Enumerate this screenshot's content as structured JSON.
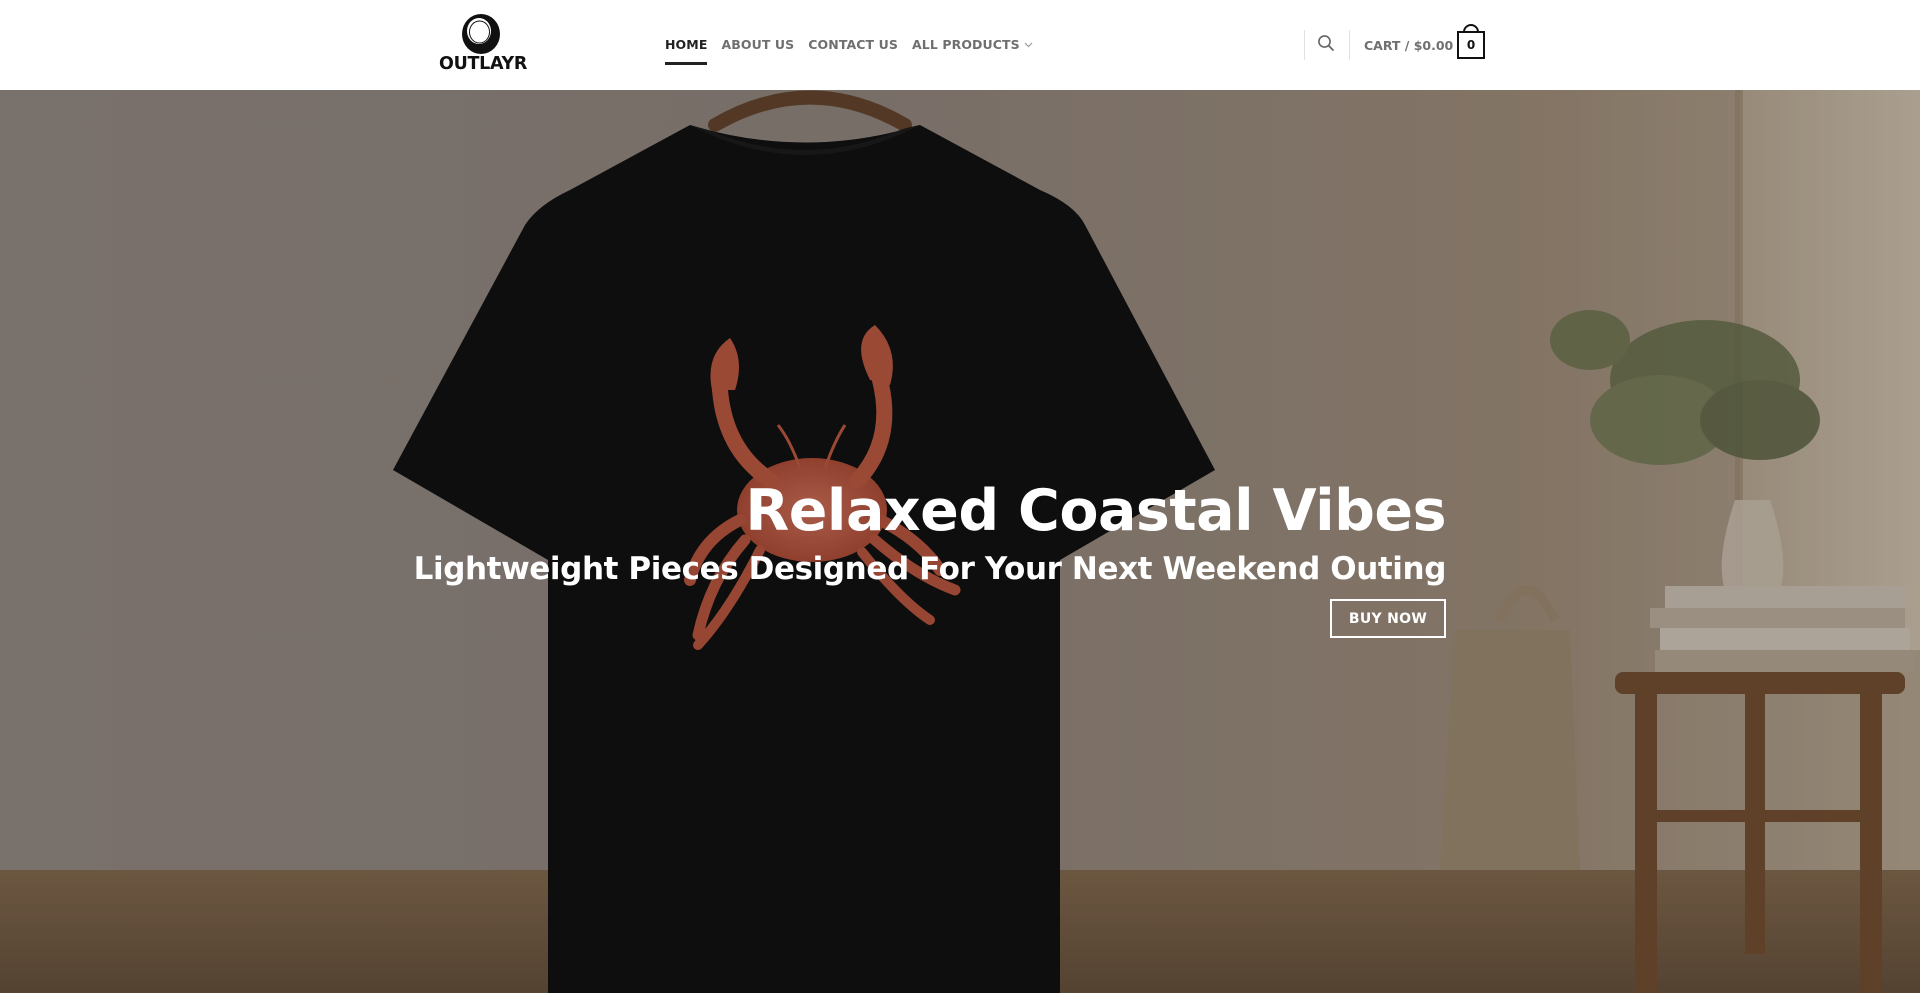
{
  "brand": {
    "name": "OUTLAYR"
  },
  "nav": {
    "items": [
      {
        "label": "HOME",
        "active": true
      },
      {
        "label": "ABOUT US",
        "active": false
      },
      {
        "label": "CONTACT US",
        "active": false
      },
      {
        "label": "ALL PRODUCTS",
        "active": false,
        "has_dropdown": true
      }
    ]
  },
  "header": {
    "search_icon": "search-icon",
    "cart_label": "CART / $0.00",
    "cart_count": "0"
  },
  "hero": {
    "title": "Relaxed Coastal Vibes",
    "subtitle": "Lightweight Pieces Designed For Your Next Weekend Outing",
    "cta_label": "BUY NOW"
  },
  "colors": {
    "header_bg": "#ffffff",
    "nav_text": "#6f6f6f",
    "nav_active": "#222222",
    "hero_text": "#ffffff"
  }
}
